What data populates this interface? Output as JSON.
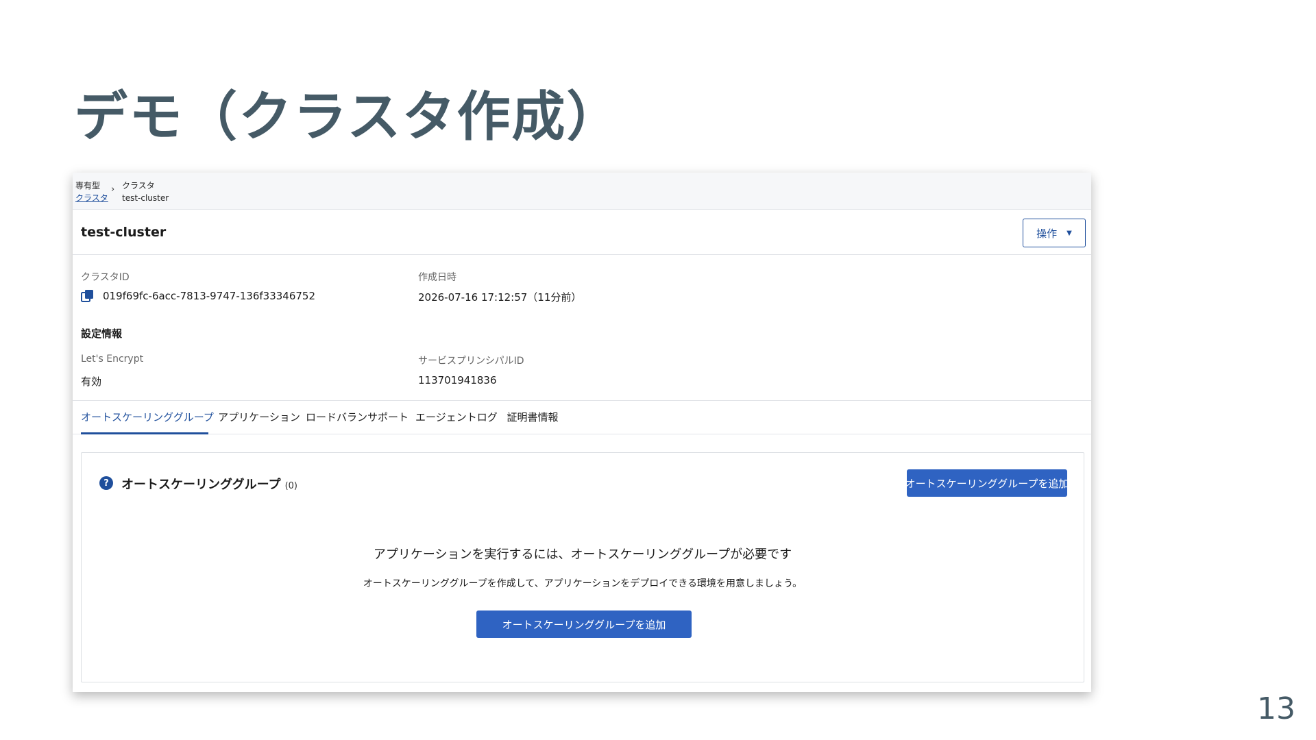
{
  "slide": {
    "title": "デモ（クラスタ作成）",
    "page_number": "13"
  },
  "breadcrumb": {
    "root_line1": "専有型",
    "root_line2": "クラスタ",
    "current_line1": "クラスタ",
    "current_line2": "test-cluster",
    "separator": "›"
  },
  "header": {
    "cluster_name": "test-cluster",
    "ops_label": "操作",
    "ops_caret": "▼"
  },
  "details": {
    "cluster_id_label": "クラスタID",
    "cluster_id_value": "019f69fc-6acc-7813-9747-136f33346752",
    "created_label": "作成日時",
    "created_value": "2026-07-16 17:12:57（11分前）",
    "settings_title": "設定情報",
    "letsencrypt_label": "Let's Encrypt",
    "letsencrypt_value": "有効",
    "principal_label": "サービスプリンシパルID",
    "principal_value": "113701941836"
  },
  "tabs": [
    {
      "label": "オートスケーリンググループ",
      "active": true
    },
    {
      "label": "アプリケーション",
      "active": false
    },
    {
      "label": "ロードバランサポート",
      "active": false
    },
    {
      "label": "エージェントログ",
      "active": false
    },
    {
      "label": "証明書情報",
      "active": false
    }
  ],
  "panel": {
    "help_glyph": "?",
    "title": "オートスケーリンググループ",
    "count": "(0)",
    "add_button_label": "オートスケーリンググループを追加",
    "empty_heading": "アプリケーションを実行するには、オートスケーリンググループが必要です",
    "empty_description": "オートスケーリンググループを作成して、アプリケーションをデプロイできる環境を用意しましょう。",
    "empty_button_label": "オートスケーリンググループを追加"
  },
  "colors": {
    "accent": "#1f4f9c",
    "primary_button": "#2f63c2",
    "slide_text": "#455a66"
  }
}
